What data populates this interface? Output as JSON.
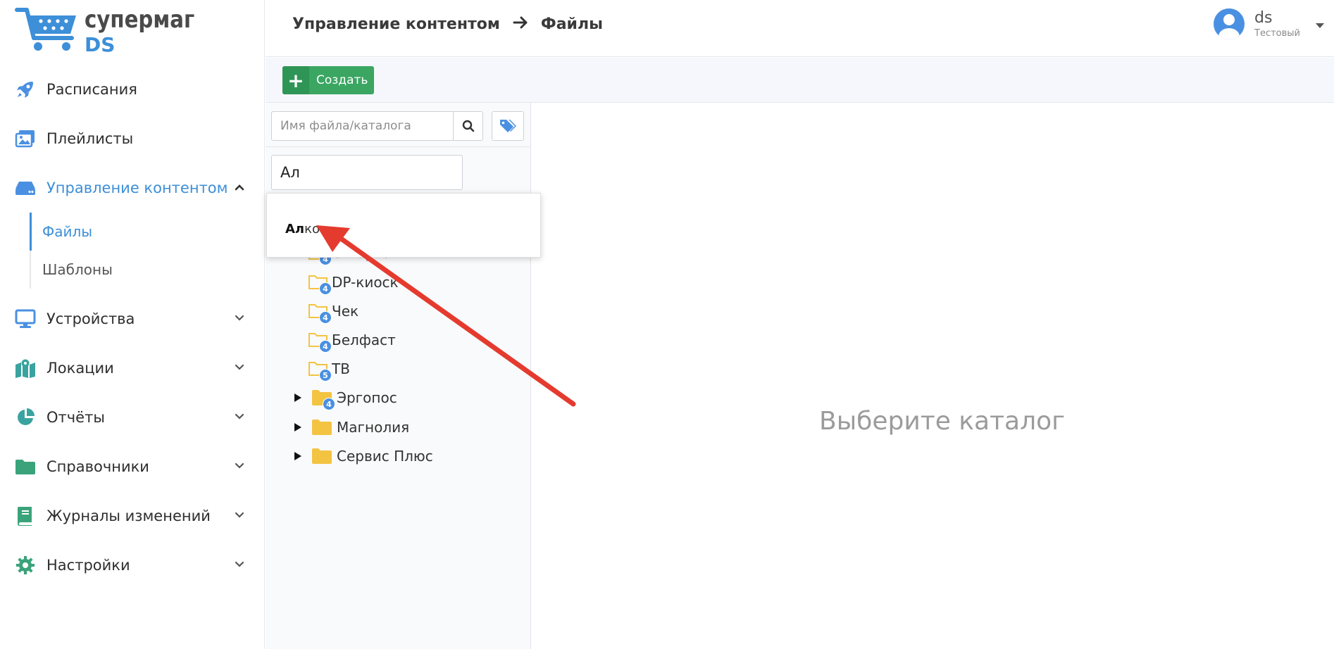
{
  "brand": {
    "name": "супермаг",
    "suffix": "DS"
  },
  "sidebar": {
    "items": [
      {
        "label": "Расписания",
        "icon": "rocket-icon"
      },
      {
        "label": "Плейлисты",
        "icon": "images-icon"
      },
      {
        "label": "Управление контентом",
        "icon": "hdd-icon",
        "expanded": true
      },
      {
        "label": "Устройства",
        "icon": "monitor-icon"
      },
      {
        "label": "Локации",
        "icon": "map-icon"
      },
      {
        "label": "Отчёты",
        "icon": "pie-chart-icon"
      },
      {
        "label": "Справочники",
        "icon": "folder-icon"
      },
      {
        "label": "Журналы изменений",
        "icon": "book-icon"
      },
      {
        "label": "Настройки",
        "icon": "gear-icon"
      }
    ],
    "submenu": [
      {
        "label": "Файлы",
        "active": true
      },
      {
        "label": "Шаблоны",
        "active": false
      }
    ]
  },
  "header": {
    "breadcrumb_parent": "Управление контентом",
    "breadcrumb_current": "Файлы",
    "user_name": "ds",
    "user_role": "Тестовый"
  },
  "toolbar": {
    "create_label": "Создать"
  },
  "search": {
    "placeholder": "Имя файла/каталога",
    "value": ""
  },
  "filter": {
    "value": "Ал"
  },
  "autocomplete": {
    "match": "Ал",
    "rest": "ко"
  },
  "tree": {
    "nodes": [
      {
        "label": "С-Картаг",
        "badge": "4"
      },
      {
        "label": "DP-киоск",
        "badge": "4"
      },
      {
        "label": "Чек",
        "badge": "4"
      },
      {
        "label": "Белфаст",
        "badge": "4"
      },
      {
        "label": "ТВ",
        "badge": "5"
      },
      {
        "label": "Эргопос",
        "badge": "4"
      },
      {
        "label": "Магнолия",
        "badge": ""
      },
      {
        "label": "Сервис Плюс",
        "badge": ""
      }
    ]
  },
  "main": {
    "empty_message": "Выберите каталог"
  },
  "colors": {
    "accent": "#3d8fd8",
    "create": "#3aa662",
    "folder": "#f3c342",
    "annotation": "#e53a2e"
  }
}
